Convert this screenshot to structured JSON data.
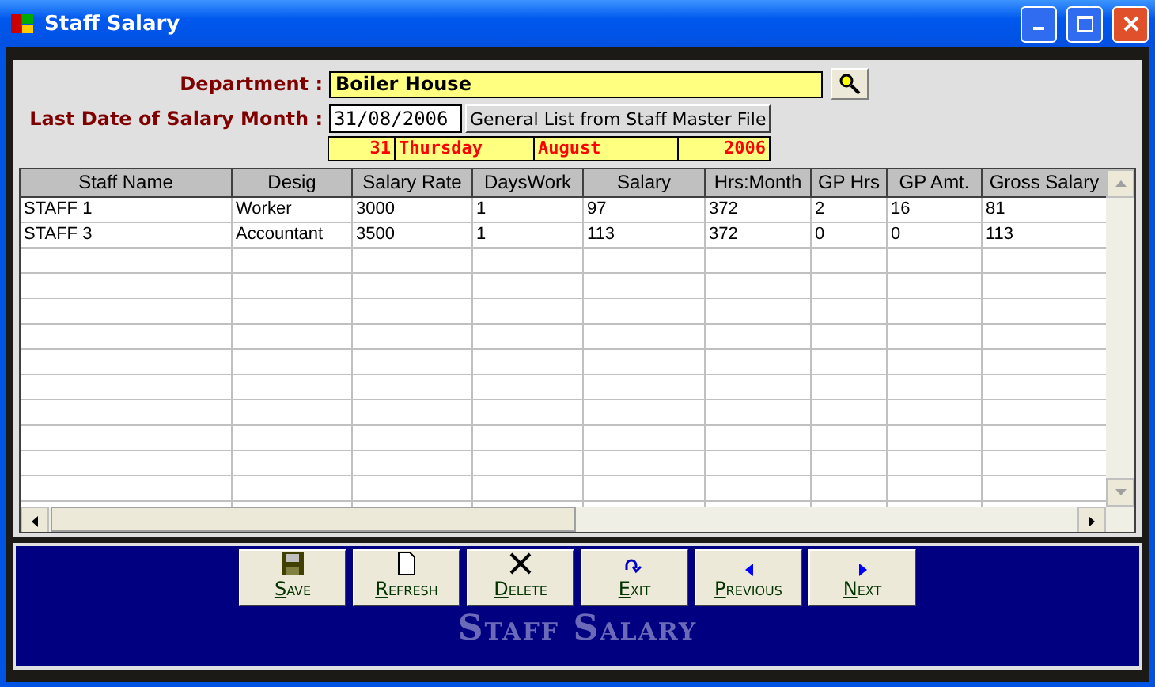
{
  "window": {
    "title": "Staff Salary"
  },
  "department": {
    "label": "Department :",
    "value": "Boiler House"
  },
  "last_date": {
    "label": "Last Date of Salary Month :",
    "value": "31/08/2006"
  },
  "general_list_button": "General List from Staff Master File",
  "date_parts": [
    {
      "text": "31",
      "kind": "day"
    },
    {
      "text": "Thursday",
      "kind": "weekday"
    },
    {
      "text": "August",
      "kind": "month"
    },
    {
      "text": "2006",
      "kind": "year"
    }
  ],
  "table": {
    "columns": [
      "Staff Name",
      "Desig",
      "Salary Rate",
      "DaysWork",
      "Salary",
      "Hrs:Month",
      "GP Hrs",
      "GP Amt.",
      "Gross Salary"
    ],
    "rows": [
      [
        "STAFF 1",
        "Worker",
        "3000",
        "1",
        "97",
        "372",
        "2",
        "16",
        "81"
      ],
      [
        "STAFF 3",
        "Accountant",
        "3500",
        "1",
        "113",
        "372",
        "0",
        "0",
        "113"
      ]
    ]
  },
  "buttons": [
    {
      "label": "Save",
      "kind": "save"
    },
    {
      "label": "Refresh",
      "kind": "refresh"
    },
    {
      "label": "Delete",
      "kind": "delete"
    },
    {
      "label": "Exit",
      "kind": "exit"
    },
    {
      "label": "Previous",
      "kind": "previous"
    },
    {
      "label": "Next",
      "kind": "next"
    }
  ],
  "footer_title": "Staff Salary"
}
